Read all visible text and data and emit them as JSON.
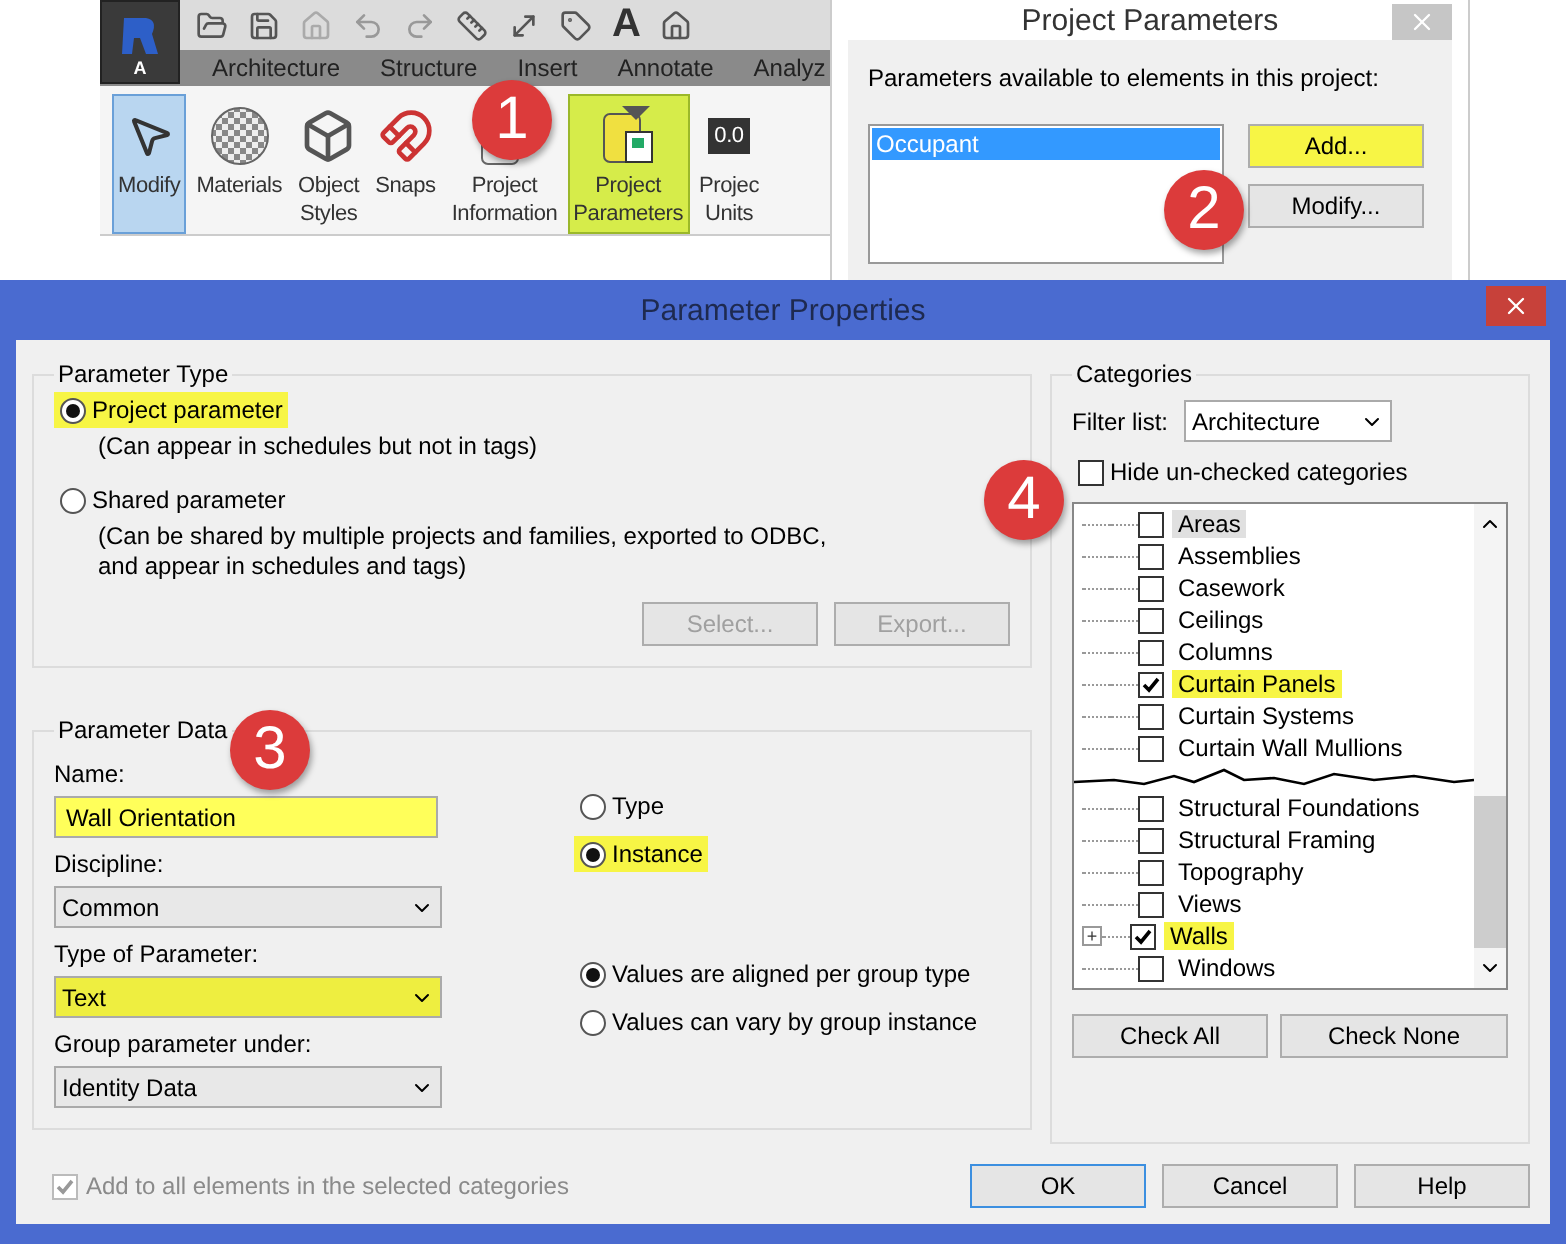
{
  "ribbon": {
    "app_letter": "A",
    "qat_text": "A",
    "tabs": [
      "Architecture",
      "Structure",
      "Insert",
      "Annotate",
      "Analyz"
    ],
    "tools": [
      {
        "kind": "modify",
        "lines": [
          "Modify"
        ],
        "selected": true,
        "highlighted": false
      },
      {
        "kind": "materials",
        "lines": [
          "Materials"
        ],
        "selected": false,
        "highlighted": false
      },
      {
        "kind": "styles",
        "lines": [
          "Object",
          "Styles"
        ],
        "selected": false,
        "highlighted": false
      },
      {
        "kind": "snaps",
        "lines": [
          "Snaps"
        ],
        "selected": false,
        "highlighted": false
      },
      {
        "kind": "info",
        "lines": [
          "Project",
          "Information"
        ],
        "selected": false,
        "highlighted": false
      },
      {
        "kind": "params",
        "lines": [
          "Project",
          "Parameters"
        ],
        "selected": false,
        "highlighted": true
      },
      {
        "kind": "units",
        "lines": [
          "Projec",
          "Units"
        ],
        "selected": false,
        "highlighted": false,
        "icon_text": "0.0"
      }
    ]
  },
  "project_parameters": {
    "title": "Project Parameters",
    "label": "Parameters available to elements in this project:",
    "items": [
      {
        "label": "Occupant",
        "selected": true
      }
    ],
    "buttons": [
      {
        "label": "Add...",
        "highlighted": true
      },
      {
        "label": "Modify...",
        "highlighted": false
      }
    ]
  },
  "dialog": {
    "title": "Parameter Properties",
    "parameter_type": {
      "title": "Parameter Type",
      "options": [
        {
          "label": "Project parameter",
          "note": "(Can appear in schedules but not in tags)",
          "selected": true,
          "highlighted": true
        },
        {
          "label": "Shared parameter",
          "note": "(Can be shared by multiple projects and families, exported to ODBC, and appear in schedules and tags)",
          "selected": false,
          "highlighted": false
        }
      ],
      "buttons": [
        {
          "label": "Select...",
          "disabled": true
        },
        {
          "label": "Export...",
          "disabled": true
        }
      ]
    },
    "parameter_data": {
      "title": "Parameter Data",
      "fields": [
        {
          "kind": "input",
          "label": "Name:",
          "value": "Wall Orientation",
          "highlighted": true
        },
        {
          "kind": "select",
          "label": "Discipline:",
          "value": "Common",
          "highlighted": false
        },
        {
          "kind": "select",
          "label": "Type of Parameter:",
          "value": "Text",
          "highlighted": true
        },
        {
          "kind": "select",
          "label": "Group parameter under:",
          "value": "Identity Data",
          "highlighted": false
        }
      ],
      "scope": [
        {
          "label": "Type",
          "selected": false,
          "highlighted": false
        },
        {
          "label": "Instance",
          "selected": true,
          "highlighted": true
        }
      ],
      "group_values": [
        {
          "label": "Values are aligned per group type",
          "selected": true
        },
        {
          "label": "Values can vary by group instance",
          "selected": false
        }
      ]
    },
    "add_to_all": {
      "label": "Add to all elements in the selected categories",
      "checked": true,
      "disabled": true
    },
    "categories": {
      "title": "Categories",
      "filter_label": "Filter list:",
      "filter_value": "Architecture",
      "hide_unchecked": {
        "label": "Hide un-checked categories",
        "checked": false
      },
      "upper": [
        {
          "label": "Areas",
          "checked": false,
          "highlighted": false,
          "focused": true,
          "expandable": false
        },
        {
          "label": "Assemblies",
          "checked": false,
          "highlighted": false,
          "focused": false,
          "expandable": false
        },
        {
          "label": "Casework",
          "checked": false,
          "highlighted": false,
          "focused": false,
          "expandable": false
        },
        {
          "label": "Ceilings",
          "checked": false,
          "highlighted": false,
          "focused": false,
          "expandable": false
        },
        {
          "label": "Columns",
          "checked": false,
          "highlighted": false,
          "focused": false,
          "expandable": false
        },
        {
          "label": "Curtain Panels",
          "checked": true,
          "highlighted": true,
          "focused": false,
          "expandable": false
        },
        {
          "label": "Curtain Systems",
          "checked": false,
          "highlighted": false,
          "focused": false,
          "expandable": false
        },
        {
          "label": "Curtain Wall Mullions",
          "checked": false,
          "highlighted": false,
          "focused": false,
          "expandable": false
        }
      ],
      "lower": [
        {
          "label": "Structural Foundations",
          "checked": false,
          "highlighted": false,
          "focused": false,
          "expandable": false
        },
        {
          "label": "Structural Framing",
          "checked": false,
          "highlighted": false,
          "focused": false,
          "expandable": false
        },
        {
          "label": "Topography",
          "checked": false,
          "highlighted": false,
          "focused": false,
          "expandable": false
        },
        {
          "label": "Views",
          "checked": false,
          "highlighted": false,
          "focused": false,
          "expandable": false
        },
        {
          "label": "Walls",
          "checked": true,
          "highlighted": true,
          "focused": false,
          "expandable": true
        },
        {
          "label": "Windows",
          "checked": false,
          "highlighted": false,
          "focused": false,
          "expandable": false
        }
      ],
      "expand_symbol": "+",
      "buttons": [
        "Check All",
        "Check None"
      ]
    },
    "buttons": [
      {
        "label": "OK",
        "default": true
      },
      {
        "label": "Cancel",
        "default": false
      },
      {
        "label": "Help",
        "default": false
      }
    ]
  },
  "callouts": [
    "1",
    "2",
    "3",
    "4"
  ]
}
